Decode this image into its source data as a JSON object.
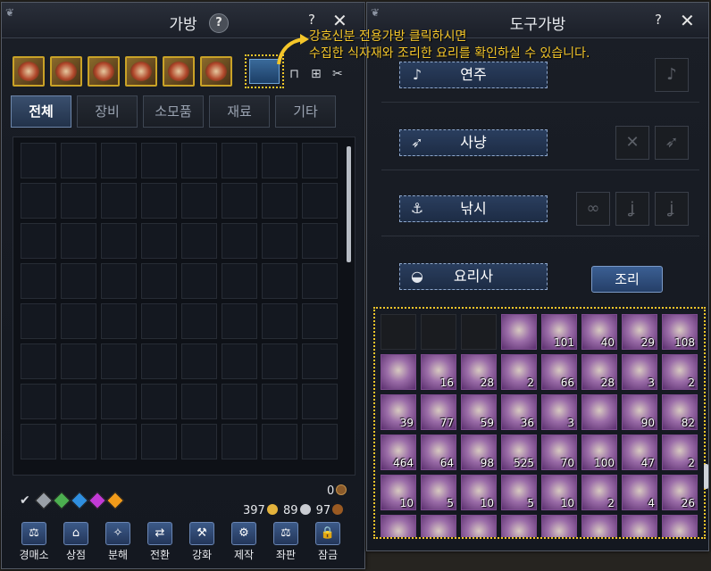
{
  "left_window": {
    "title": "가방",
    "help": "?",
    "close": "✕",
    "tabs": [
      "전체",
      "장비",
      "소모품",
      "재료",
      "기타"
    ],
    "money": {
      "top_value": "0",
      "gold": "397",
      "silver": "89",
      "copper": "97"
    },
    "bottom_buttons": [
      "경매소",
      "상점",
      "분해",
      "전환",
      "강화",
      "제작",
      "좌판",
      "잠금"
    ]
  },
  "right_window": {
    "title": "도구가방",
    "help": "?",
    "close": "✕",
    "sections": [
      "연주",
      "사냥",
      "낚시",
      "요리사"
    ],
    "cook_button": "조리"
  },
  "tooltip": {
    "line1": "강호신분 전용가방 클릭하시면",
    "line2": "수집한 식자재와 조리한 요리를 확인하실 수 있습니다."
  },
  "ingredients": {
    "row1": [
      "",
      "",
      "",
      "",
      "101",
      "40",
      "29",
      "108"
    ],
    "row2": [
      "",
      "16",
      "28",
      "2",
      "66",
      "28",
      "3",
      "2"
    ],
    "row3": [
      "39",
      "77",
      "59",
      "36",
      "3",
      "",
      "90",
      "82"
    ],
    "row4": [
      "464",
      "64",
      "98",
      "525",
      "70",
      "100",
      "47",
      "2"
    ],
    "row5": [
      "10",
      "5",
      "10",
      "5",
      "10",
      "2",
      "4",
      "26"
    ]
  },
  "colors": {
    "accent": "#f4c62a",
    "tab_active": "#3a4f6e",
    "gems": [
      "#9aa0a8",
      "#4caf50",
      "#2f8fe0",
      "#c23ad6",
      "#f29b1a"
    ]
  }
}
